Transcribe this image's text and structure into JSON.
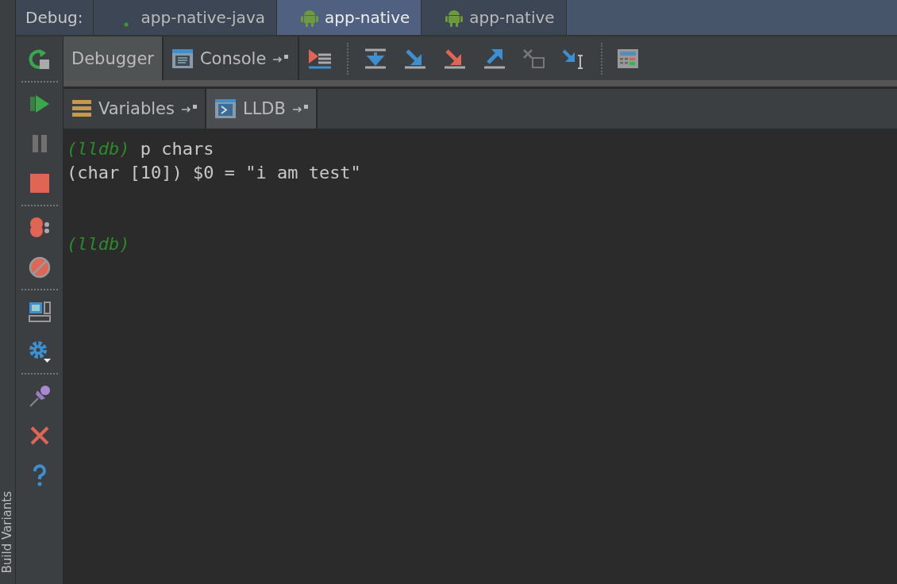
{
  "side_panel": {
    "label": "Build Variants"
  },
  "debug_bar": {
    "label": "Debug:",
    "tabs": [
      {
        "label": "app-native-java",
        "kind": "dot",
        "selected": false
      },
      {
        "label": "app-native",
        "kind": "android",
        "selected": true
      },
      {
        "label": "app-native",
        "kind": "android",
        "selected": false
      }
    ]
  },
  "debugger_tabs": [
    {
      "label": "Debugger",
      "kind": "plain",
      "selected": true
    },
    {
      "label": "Console",
      "kind": "console",
      "selected": false
    }
  ],
  "session_tabs": [
    {
      "label": "Variables",
      "kind": "variables",
      "selected": false
    },
    {
      "label": "LLDB",
      "kind": "lldb",
      "selected": true
    }
  ],
  "console_lines": [
    {
      "kind": "command",
      "prompt": "(lldb)",
      "text": "p chars"
    },
    {
      "kind": "output",
      "text": "(char [10]) $0 = \"i am test\""
    },
    {
      "kind": "blank"
    },
    {
      "kind": "blank"
    },
    {
      "kind": "prompt",
      "prompt": "(lldb)"
    }
  ]
}
